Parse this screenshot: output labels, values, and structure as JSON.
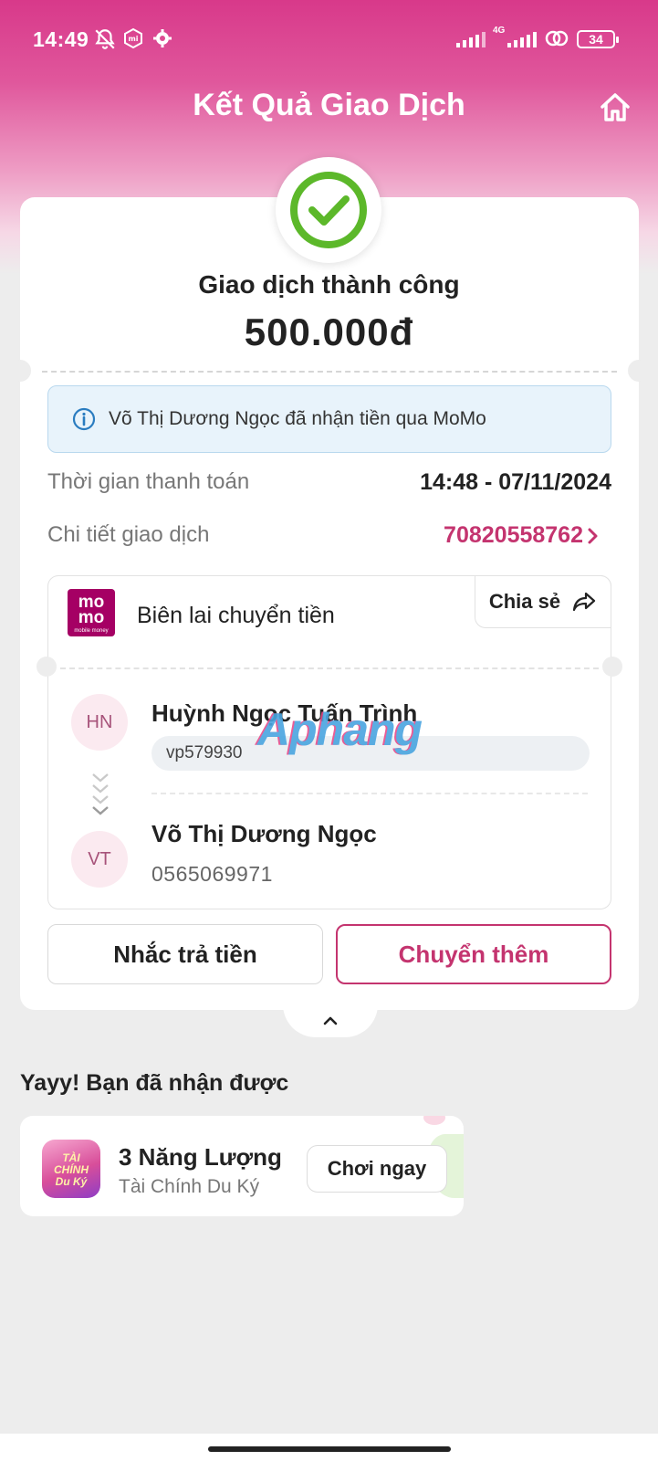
{
  "status_bar": {
    "time": "14:49",
    "network": "4G",
    "battery": "34"
  },
  "header": {
    "title": "Kết Quả Giao Dịch",
    "home_icon": "home-icon"
  },
  "result": {
    "status": "Giao dịch thành công",
    "amount": "500.000đ",
    "icon": "success-check-icon",
    "accent_color": "#5cb82a"
  },
  "info_banner": {
    "text": "Võ Thị Dương Ngọc đã nhận tiền qua MoMo",
    "icon": "info-icon"
  },
  "details": {
    "payment_time_label": "Thời gian thanh toán",
    "payment_time_value": "14:48 - 07/11/2024",
    "transaction_label": "Chi tiết giao dịch",
    "transaction_value": "70820558762"
  },
  "receipt": {
    "logo_top": "mo",
    "logo_bottom": "mo",
    "logo_sub": "mobile money",
    "title": "Biên lai chuyển tiền",
    "share_label": "Chia sẻ",
    "watermark": "Aphang",
    "sender": {
      "initials": "HN",
      "name": "Huỳnh Ngọc Tuấn Trình",
      "account": "vp579930"
    },
    "receiver": {
      "initials": "VT",
      "name": "Võ Thị Dương Ngọc",
      "phone": "0565069971"
    }
  },
  "actions": {
    "remind_label": "Nhắc trả tiền",
    "transfer_more_label": "Chuyển thêm"
  },
  "rewards": {
    "section_title": "Yayy! Bạn đã nhận được",
    "item_name": "3 Năng Lượng",
    "item_sub": "Tài Chính Du Ký",
    "game_icon_text_1": "TÀI",
    "game_icon_text_2": "CHÍNH",
    "game_icon_text_3": "Du Ký",
    "play_label": "Chơi ngay"
  },
  "colors": {
    "brand": "#a50064",
    "accent": "#c4346f",
    "header_gradient_top": "#d8398a"
  }
}
